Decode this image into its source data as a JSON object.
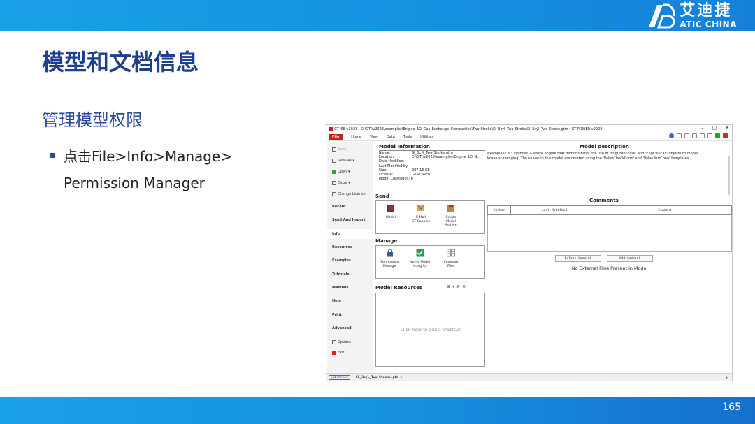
{
  "slide": {
    "title": "模型和文档信息",
    "subtitle": "管理模型权限",
    "bullet_line1": "点击File>Info>Manage>",
    "bullet_line2": "Permission Manager",
    "page_number": "165",
    "logo_cn": "艾迪捷",
    "logo_en": "ATIC CHINA",
    "colors": {
      "banner": "#1a96e4",
      "title": "#1e3f8f"
    }
  },
  "app": {
    "window_title": "GT-ISE v2023 - D:\\GTI\\v2023\\examples\\Engine_1D_Gas_Exchange_Combustion\\Two-Stroke\\SI_3cyl_Two-Stroke\\SI_3cyl_Two-Stroke.gtm : GT-POWER v2023",
    "window_buttons": [
      "–",
      "▢",
      "✕"
    ],
    "menu": {
      "file": "File",
      "items": [
        "Home",
        "View",
        "Data",
        "Tools",
        "Utilities"
      ]
    },
    "sidebar": {
      "save": "Save",
      "save_as": "Save As",
      "open": "Open",
      "close": "Close",
      "change_license": "Change License",
      "recent": "Recent",
      "send_and_import": "Send And Import",
      "info": "Info",
      "resources": "Resources",
      "examples": "Examples",
      "tutorials": "Tutorials",
      "manuals": "Manuals",
      "help": "Help",
      "print": "Print",
      "advanced": "Advanced",
      "options": "Options",
      "exit": "Exit"
    },
    "model_info": {
      "heading": "Model Information",
      "name_label": "Name:",
      "name_value": "SI_3cyl_Two-Stroke.gtm",
      "location_label": "Location:",
      "location_value": "D:\\GTI\\v2023\\examples\\Engine_1D_G...",
      "date_modified": "Date Modified:",
      "last_modified_by": "Last Modified by:",
      "size_label": "Size:",
      "size_value": "287.15 KB",
      "license_label": "License:",
      "license_value": "GT-POWER",
      "created_in": "Model Created in: 6"
    },
    "send": {
      "heading": "Send",
      "model": "Model",
      "email_line1": "E-Mail",
      "email_line2": "GT Support",
      "archive_line1": "Create",
      "archive_line2": "Model Archive"
    },
    "manage": {
      "heading": "Manage",
      "perm_line1": "Permissions",
      "perm_line2": "Manager",
      "verify_line1": "Verify Model",
      "verify_line2": "Integrity",
      "compare_line1": "Compare",
      "compare_line2": "Files"
    },
    "resources": {
      "heading": "Model Resources",
      "placeholder": "Click here to add a shortcut"
    },
    "description": {
      "heading": "Model description",
      "text_line1": "example is a 3 cylinder 2-stroke engine that demonstrates the use of 'EngCrankcase' and 'EngCylScav' objects to model",
      "text_line2": "kcase scavenging.  The valves in this model are created using the 'ValveCheckConn' and 'ValvePortConn' templates."
    },
    "comments": {
      "heading": "Comments",
      "col_author": "Author",
      "col_modified": "Last Modified",
      "col_comment": "Comment",
      "delete_btn": "Delete Comment",
      "add_btn": "Add Comment",
      "no_files": "No External Files Present in Model"
    },
    "statusbar": {
      "tab1": "Libraries",
      "tab2": "SI_3cyl_Two-Stroke.gtm ×"
    }
  }
}
